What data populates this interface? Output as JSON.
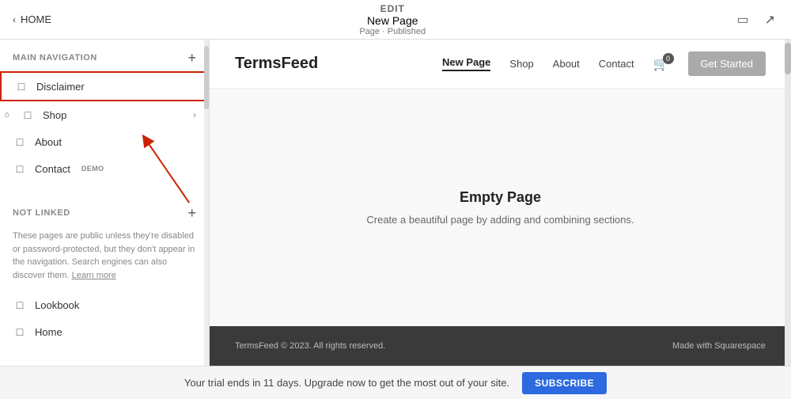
{
  "topbar": {
    "edit_label": "EDIT",
    "page_title": "New Page",
    "page_status": "Page · Published",
    "back_label": "HOME"
  },
  "sidebar": {
    "main_nav_label": "MAIN NAVIGATION",
    "add_icon": "+",
    "items": [
      {
        "id": "disclaimer",
        "label": "Disclaimer",
        "selected": true,
        "home": false,
        "hasChevron": false
      },
      {
        "id": "shop",
        "label": "Shop",
        "selected": false,
        "home": true,
        "hasChevron": true
      },
      {
        "id": "about",
        "label": "About",
        "selected": false,
        "home": false,
        "hasChevron": false
      },
      {
        "id": "contact",
        "label": "Contact",
        "selected": false,
        "home": false,
        "badge": "DEMO",
        "hasChevron": false
      }
    ],
    "not_linked_label": "NOT LINKED",
    "not_linked_desc": "These pages are public unless they're disabled or password-protected, but they don't appear in the navigation. Search engines can also discover them.",
    "learn_more": "Learn more",
    "not_linked_items": [
      {
        "id": "lookbook",
        "label": "Lookbook"
      },
      {
        "id": "home",
        "label": "Home"
      }
    ]
  },
  "website": {
    "logo": "TermsFeed",
    "nav_items": [
      {
        "label": "New Page",
        "active": true
      },
      {
        "label": "Shop",
        "active": false
      },
      {
        "label": "About",
        "active": false
      },
      {
        "label": "Contact",
        "active": false
      }
    ],
    "cart_count": "0",
    "get_started_label": "Get Started",
    "empty_page_title": "Empty Page",
    "empty_page_desc": "Create a beautiful page by adding and combining sections.",
    "footer_copyright": "TermsFeed © 2023. All rights reserved.",
    "footer_made_with": "Made with Squarespace"
  },
  "trial_bar": {
    "message": "Your trial ends in 11 days. Upgrade now to get the most out of your site.",
    "subscribe_label": "SUBSCRIBE"
  }
}
